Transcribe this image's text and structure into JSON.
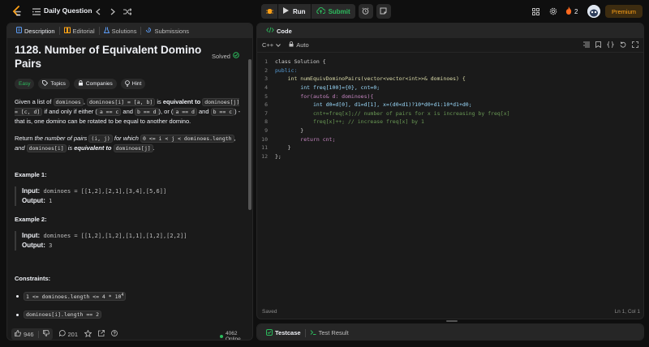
{
  "topbar": {
    "problem_list_label": "Daily Question",
    "run_label": "Run",
    "submit_label": "Submit",
    "streak_count": "2",
    "premium_label": "Premium"
  },
  "desc_tabs": [
    "Description",
    "Editorial",
    "Solutions",
    "Submissions"
  ],
  "problem": {
    "title": "1128. Number of Equivalent Domino Pairs",
    "solved_label": "Solved",
    "difficulty": "Easy",
    "tags": [
      "Topics",
      "Companies",
      "Hint"
    ],
    "p1_a": "Given a list of ",
    "p1_code1": "dominoes",
    "p1_b": ", ",
    "p1_code2": "dominoes[i] = [a, b]",
    "p1_c": " is ",
    "p1_bold": "equivalent to",
    "p1_d": " ",
    "p1_code3": "dominoes[j] = [c, d]",
    "p1_e": " if and only if either (",
    "p1_code4": "a == c",
    "p1_f": " and ",
    "p1_code5": "b == d",
    "p1_g": "), or (",
    "p1_code6": "a == d",
    "p1_h": " and ",
    "p1_code7": "b == c",
    "p1_i": ") - that is, one domino can be rotated to be equal to another domino.",
    "p2_a": "Return ",
    "p2_em": "the number of pairs ",
    "p2_code1": "(i, j)",
    "p2_em2": " for which ",
    "p2_code2": "0 <= i < j < dominoes.length",
    "p2_em3": ", and ",
    "p2_code3": "dominoes[i]",
    "p2_em4": " is ",
    "p2_bold": "equivalent to",
    "p2_em5": " ",
    "p2_code4": "dominoes[j]",
    "p2_end": ".",
    "example1_title": "Example 1:",
    "example1_input_label": "Input:",
    "example1_input": "dominoes = [[1,2],[2,1],[3,4],[5,6]]",
    "example1_output_label": "Output:",
    "example1_output": "1",
    "example2_title": "Example 2:",
    "example2_input_label": "Input:",
    "example2_input": "dominoes = [[1,2],[1,2],[1,1],[1,2],[2,2]]",
    "example2_output_label": "Output:",
    "example2_output": "3",
    "constraints_title": "Constraints:",
    "constraint1_a": "1 <= dominoes.length <= 4 * 10",
    "constraint1_sup": "4",
    "constraint2": "dominoes[i].length == 2"
  },
  "footer": {
    "likes": "946",
    "comments": "201",
    "online": "4062 Online"
  },
  "code": {
    "panel_title": "Code",
    "language": "C++",
    "autosave": "Auto",
    "status_left": "Saved",
    "status_right": "Ln 1, Col 1"
  },
  "code_lines": [
    "class Solution {",
    "public:",
    "    int numEquivDominoPairs(vector<vector<int>>& dominoes) {",
    "        int freq[100]={0}, cnt=0;",
    "        for(auto& d: dominoes){",
    "            int d0=d[0], d1=d[1], x=(d0<d1)?10*d0+d1:10*d1+d0;",
    "            cnt+=freq[x];// number of pairs for x is increasing by freq[x]",
    "            freq[x]++; // increase freq[x] by 1",
    "        }",
    "        return cnt;",
    "    }",
    "};"
  ],
  "test_tabs": [
    "Testcase",
    "Test Result"
  ]
}
